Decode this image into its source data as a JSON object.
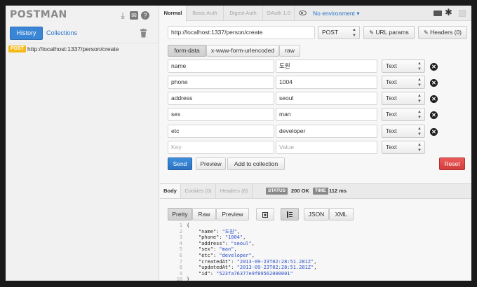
{
  "sidebar": {
    "logo": "POSTMAN",
    "history_tab": "History",
    "collections_tab": "Collections",
    "history": [
      {
        "method": "POST",
        "url": "http://localhost:1337/person/create"
      }
    ]
  },
  "tabs": [
    "Normal",
    "Basic Auth",
    "Digest Auth",
    "OAuth 1.0"
  ],
  "environment": "No environment",
  "request": {
    "url": "http://localhost:1337/person/create",
    "method": "POST",
    "url_params_label": "URL params",
    "headers_label": "Headers (0)"
  },
  "body_tabs": [
    "form-data",
    "x-www-form-urlencoded",
    "raw"
  ],
  "params": [
    {
      "key": "name",
      "value": "도원",
      "type": "Text"
    },
    {
      "key": "phone",
      "value": "1004",
      "type": "Text"
    },
    {
      "key": "address",
      "value": "seoul",
      "type": "Text"
    },
    {
      "key": "sex",
      "value": "man",
      "type": "Text"
    },
    {
      "key": "etc",
      "value": "developer",
      "type": "Text"
    }
  ],
  "new_param": {
    "key_placeholder": "Key",
    "value_placeholder": "Value",
    "type": "Text"
  },
  "actions": {
    "send": "Send",
    "preview": "Preview",
    "add_to_collection": "Add to collection",
    "reset": "Reset"
  },
  "response": {
    "tabs": [
      "Body",
      "Cookies (0)",
      "Headers (8)"
    ],
    "status_label": "STATUS",
    "status_value": "200 OK",
    "time_label": "TIME",
    "time_value": "112 ms",
    "view_tabs": [
      "Pretty",
      "Raw",
      "Preview"
    ],
    "format_tabs": [
      "JSON",
      "XML"
    ],
    "code_lines": [
      "{",
      "    \"name\": \"도원\",",
      "    \"phone\": \"1004\",",
      "    \"address\": \"seoul\",",
      "    \"sex\": \"man\",",
      "    \"etc\": \"developer\",",
      "    \"createdAt\": \"2013-09-23T02:28:51.281Z\",",
      "    \"updatedAt\": \"2013-09-23T02:28:51.281Z\",",
      "    \"id\": \"523fa76377e9f89562000001\"",
      "}"
    ]
  }
}
